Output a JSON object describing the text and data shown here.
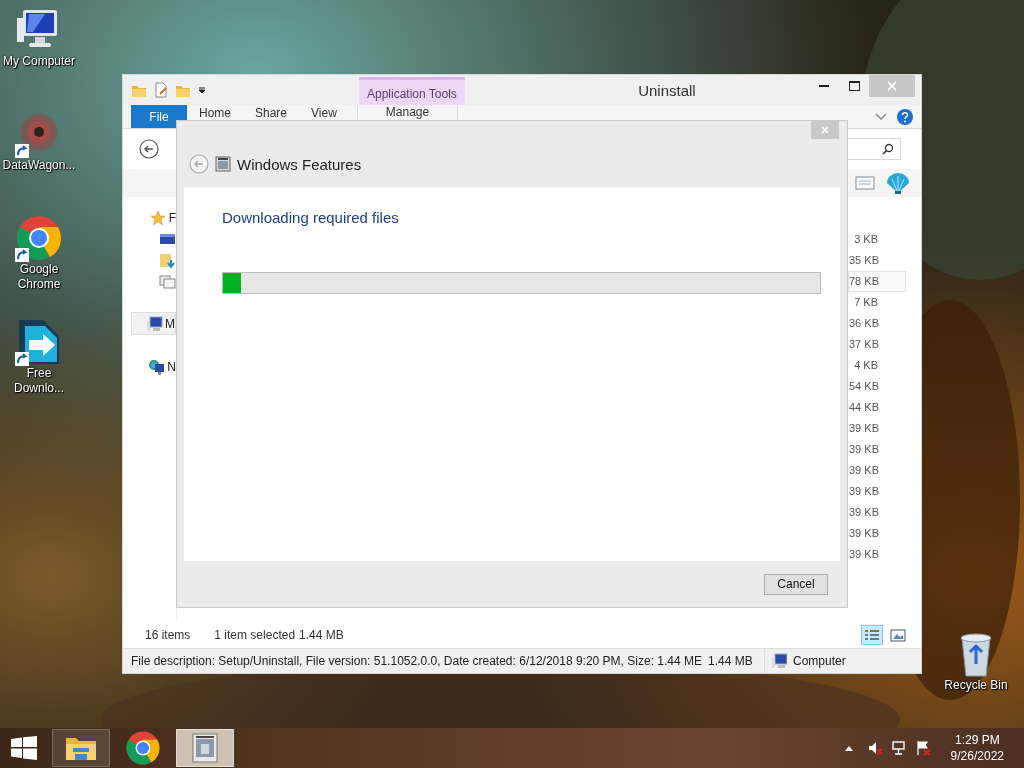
{
  "desktop": {
    "icons": [
      {
        "kind": "computer",
        "label": "My Computer",
        "shortcut": false
      },
      {
        "kind": "datawagon",
        "label": "DataWagon...",
        "shortcut": true
      },
      {
        "kind": "chrome",
        "label": "Google Chrome",
        "shortcut": true
      },
      {
        "kind": "download",
        "label": "Free Downlo...",
        "shortcut": true
      }
    ],
    "recycle_bin": {
      "label": "Recycle Bin"
    }
  },
  "explorer": {
    "title": "Uninstall",
    "context_tab": "Application Tools",
    "file_tab": "File",
    "ribbon_tabs": [
      {
        "label": "Home",
        "kind": "tab"
      },
      {
        "label": "Share",
        "kind": "tab"
      },
      {
        "label": "View",
        "kind": "tab"
      },
      {
        "label": "Manage",
        "kind": "context"
      }
    ],
    "nav_items": [
      {
        "kind": "favorites",
        "label": "F",
        "selected": false
      },
      {
        "kind": "desktop",
        "selected": false
      },
      {
        "kind": "downloads",
        "selected": false
      },
      {
        "kind": "recent",
        "selected": false
      },
      {
        "kind": "computer",
        "label": "M",
        "selected": true
      },
      {
        "kind": "network",
        "label": "N",
        "selected": false
      }
    ],
    "sizes": [
      {
        "text": "3 KB",
        "selected": false
      },
      {
        "text": "35 KB",
        "selected": false
      },
      {
        "text": "78 KB",
        "selected": true
      },
      {
        "text": "7 KB",
        "selected": false
      },
      {
        "text": "36 KB",
        "selected": false
      },
      {
        "text": "37 KB",
        "selected": false
      },
      {
        "text": "4 KB",
        "selected": false
      },
      {
        "text": "54 KB",
        "selected": false
      },
      {
        "text": "44 KB",
        "selected": false
      },
      {
        "text": "39 KB",
        "selected": false
      },
      {
        "text": "39 KB",
        "selected": false
      },
      {
        "text": "39 KB",
        "selected": false
      },
      {
        "text": "39 KB",
        "selected": false
      },
      {
        "text": "39 KB",
        "selected": false
      },
      {
        "text": "39 KB",
        "selected": false
      },
      {
        "text": "39 KB",
        "selected": false
      }
    ],
    "status": {
      "item_count": "16 items",
      "selection": "1 item selected",
      "selection_size": "1.44 MB"
    },
    "view_buttons": [
      {
        "kind": "details",
        "selected": true
      },
      {
        "kind": "thumbnails",
        "selected": false
      }
    ],
    "details_bar": {
      "description": "File description: Setup/Uninstall, File version: 51.1052.0.0, Date created: 6/12/2018 9:20 PM, Size: 1.44 ME",
      "size": "1.44 MB",
      "location": "Computer"
    }
  },
  "dialog": {
    "title": "Windows Features",
    "heading": "Downloading required files",
    "progress": {
      "level": 0.03
    },
    "buttons": [
      "Cancel"
    ]
  },
  "taskbar": {
    "apps": [
      {
        "kind": "explorer",
        "selected": false
      },
      {
        "kind": "chrome",
        "selected": false
      },
      {
        "kind": "features",
        "selected": true
      }
    ],
    "tray": [
      {
        "kind": "overflow"
      },
      {
        "kind": "volume-muted"
      },
      {
        "kind": "network"
      },
      {
        "kind": "flag"
      }
    ],
    "time": "1:29 PM",
    "date": "9/26/2022"
  }
}
